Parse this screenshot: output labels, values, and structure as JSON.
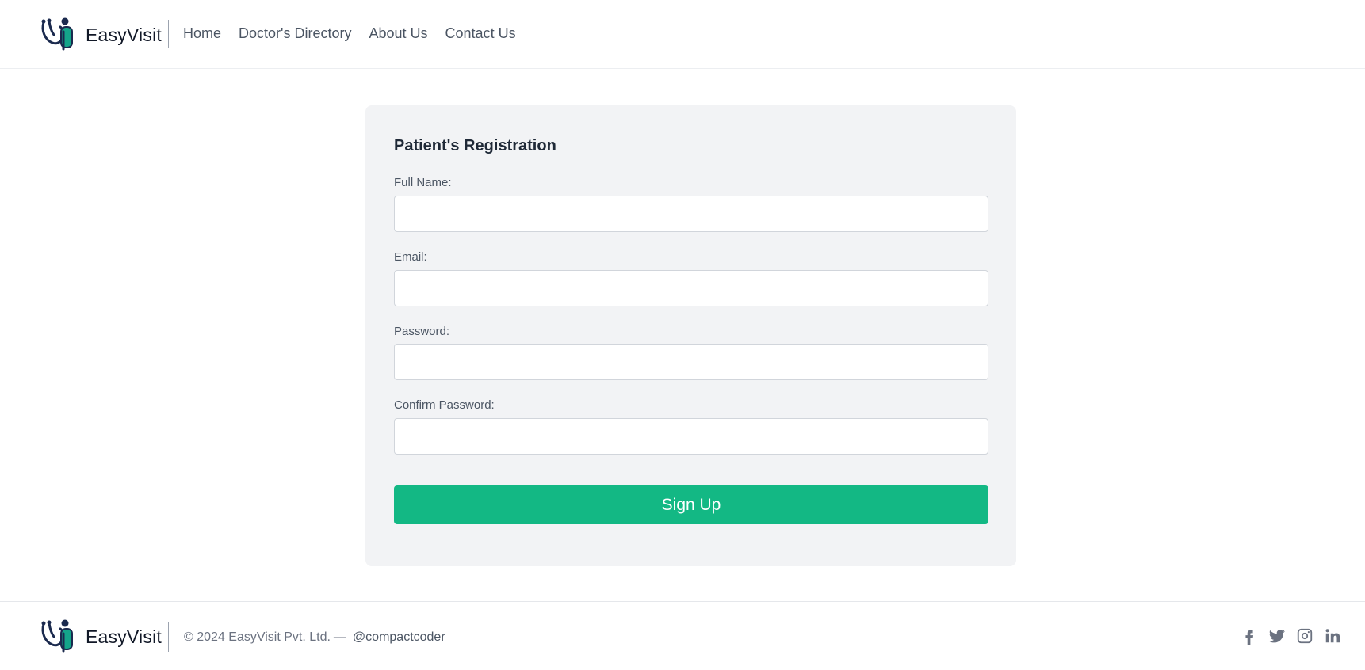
{
  "brand": {
    "name": "EasyVisit"
  },
  "nav": {
    "home": "Home",
    "directory": "Doctor's Directory",
    "about": "About Us",
    "contact": "Contact Us"
  },
  "form": {
    "title": "Patient's Registration",
    "full_name_label": "Full Name:",
    "full_name_value": "",
    "email_label": "Email:",
    "email_value": "",
    "password_label": "Password:",
    "password_value": "",
    "confirm_label": "Confirm Password:",
    "confirm_value": "",
    "submit_label": "Sign Up"
  },
  "footer": {
    "brand": "EasyVisit",
    "copyright": "© 2024 EasyVisit Pvt. Ltd.",
    "separator": "—",
    "handle": "@compactcoder",
    "socials": [
      "facebook-icon",
      "twitter-icon",
      "instagram-icon",
      "linkedin-icon"
    ]
  },
  "colors": {
    "accent": "#13b884",
    "card_bg": "#f2f3f5",
    "logo_dark": "#1b2a4e",
    "logo_teal": "#14a58a"
  }
}
